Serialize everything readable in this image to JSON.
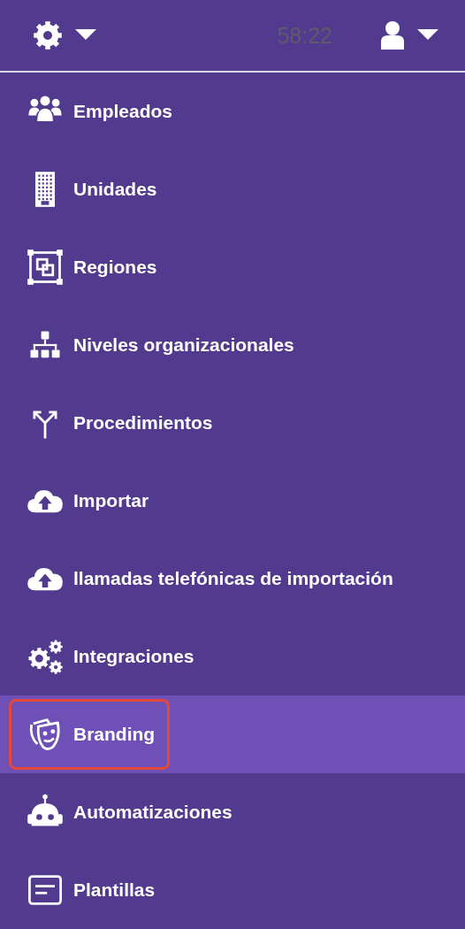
{
  "header": {
    "timer": "58:22"
  },
  "menu": [
    {
      "label": "Empleados",
      "selected": false,
      "outlined": false
    },
    {
      "label": "Unidades",
      "selected": false,
      "outlined": false
    },
    {
      "label": "Regiones",
      "selected": false,
      "outlined": false
    },
    {
      "label": "Niveles organizacionales",
      "selected": false,
      "outlined": false
    },
    {
      "label": "Procedimientos",
      "selected": false,
      "outlined": false
    },
    {
      "label": "Importar",
      "selected": false,
      "outlined": false
    },
    {
      "label": "llamadas telefónicas de importación",
      "selected": false,
      "outlined": false
    },
    {
      "label": "Integraciones",
      "selected": false,
      "outlined": false
    },
    {
      "label": "Branding",
      "selected": true,
      "outlined": true
    },
    {
      "label": "Automatizaciones",
      "selected": false,
      "outlined": false
    },
    {
      "label": "Plantillas",
      "selected": false,
      "outlined": false
    }
  ]
}
